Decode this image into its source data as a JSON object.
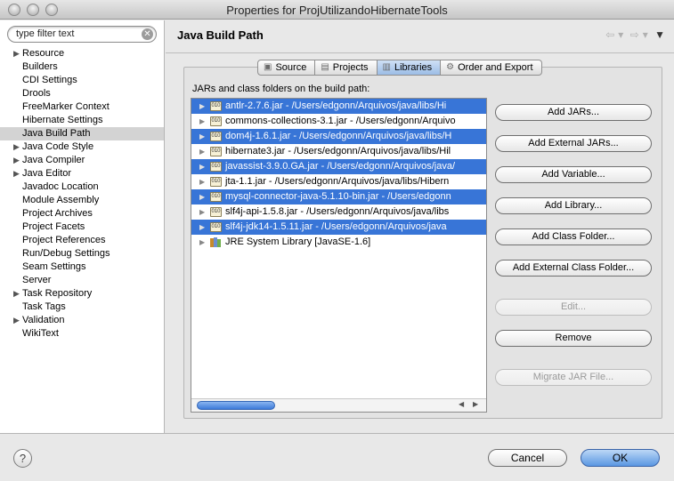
{
  "window": {
    "title": "Properties for ProjUtilizandoHibernateTools"
  },
  "search": {
    "placeholder": "type filter text",
    "value": "type filter text"
  },
  "sidebar": {
    "items": [
      {
        "label": "Resource",
        "expandable": true
      },
      {
        "label": "Builders",
        "expandable": false
      },
      {
        "label": "CDI Settings",
        "expandable": false
      },
      {
        "label": "Drools",
        "expandable": false
      },
      {
        "label": "FreeMarker Context",
        "expandable": false
      },
      {
        "label": "Hibernate Settings",
        "expandable": false
      },
      {
        "label": "Java Build Path",
        "expandable": false,
        "selected": true
      },
      {
        "label": "Java Code Style",
        "expandable": true
      },
      {
        "label": "Java Compiler",
        "expandable": true
      },
      {
        "label": "Java Editor",
        "expandable": true
      },
      {
        "label": "Javadoc Location",
        "expandable": false
      },
      {
        "label": "Module Assembly",
        "expandable": false
      },
      {
        "label": "Project Archives",
        "expandable": false
      },
      {
        "label": "Project Facets",
        "expandable": false
      },
      {
        "label": "Project References",
        "expandable": false
      },
      {
        "label": "Run/Debug Settings",
        "expandable": false
      },
      {
        "label": "Seam Settings",
        "expandable": false
      },
      {
        "label": "Server",
        "expandable": false
      },
      {
        "label": "Task Repository",
        "expandable": true
      },
      {
        "label": "Task Tags",
        "expandable": false
      },
      {
        "label": "Validation",
        "expandable": true
      },
      {
        "label": "WikiText",
        "expandable": false
      }
    ]
  },
  "header": {
    "title": "Java Build Path",
    "nav": {
      "back": "⇦",
      "back_menu": "▾",
      "forward": "⇨",
      "forward_menu": "▾",
      "menu": "▼"
    }
  },
  "tabs": [
    {
      "label": "Source",
      "icon": "source-folder-icon",
      "active": false
    },
    {
      "label": "Projects",
      "icon": "projects-icon",
      "active": false
    },
    {
      "label": "Libraries",
      "icon": "libraries-icon",
      "active": true
    },
    {
      "label": "Order and Export",
      "icon": "order-export-icon",
      "active": false
    }
  ],
  "libraries": {
    "label": "JARs and class folders on the build path:",
    "entries": [
      {
        "text": "antlr-2.7.6.jar - /Users/edgonn/Arquivos/java/libs/Hi",
        "selected": true,
        "kind": "jar"
      },
      {
        "text": "commons-collections-3.1.jar - /Users/edgonn/Arquivo",
        "selected": false,
        "kind": "jar"
      },
      {
        "text": "dom4j-1.6.1.jar - /Users/edgonn/Arquivos/java/libs/H",
        "selected": true,
        "kind": "jar"
      },
      {
        "text": "hibernate3.jar - /Users/edgonn/Arquivos/java/libs/Hil",
        "selected": false,
        "kind": "jar"
      },
      {
        "text": "javassist-3.9.0.GA.jar - /Users/edgonn/Arquivos/java/",
        "selected": true,
        "kind": "jar"
      },
      {
        "text": "jta-1.1.jar - /Users/edgonn/Arquivos/java/libs/Hibern",
        "selected": false,
        "kind": "jar"
      },
      {
        "text": "mysql-connector-java-5.1.10-bin.jar - /Users/edgonn",
        "selected": true,
        "kind": "jar"
      },
      {
        "text": "slf4j-api-1.5.8.jar - /Users/edgonn/Arquivos/java/libs",
        "selected": false,
        "kind": "jar"
      },
      {
        "text": "slf4j-jdk14-1.5.11.jar - /Users/edgonn/Arquivos/java",
        "selected": true,
        "kind": "jar"
      },
      {
        "text": "JRE System Library [JavaSE-1.6]",
        "selected": false,
        "kind": "library"
      }
    ]
  },
  "buttons": {
    "add_jars": "Add JARs...",
    "add_external_jars": "Add External JARs...",
    "add_variable": "Add Variable...",
    "add_library": "Add Library...",
    "add_class_folder": "Add Class Folder...",
    "add_external_class_folder": "Add External Class Folder...",
    "edit": "Edit...",
    "remove": "Remove",
    "migrate_jar": "Migrate JAR File..."
  },
  "footer": {
    "help": "?",
    "cancel": "Cancel",
    "ok": "OK"
  },
  "colors": {
    "selection": "#3875d7",
    "ok_button": "#5a97e2"
  }
}
